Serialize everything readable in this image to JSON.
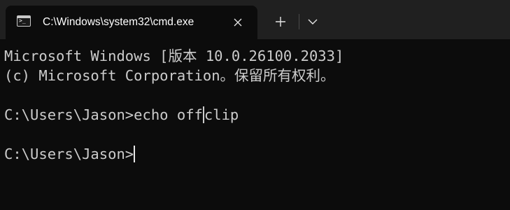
{
  "tab": {
    "title": "C:\\Windows\\system32\\cmd.exe",
    "icon": "cmd-terminal-icon",
    "close_icon": "close-icon"
  },
  "toolbar": {
    "new_tab_icon": "plus-icon",
    "dropdown_icon": "chevron-down-icon"
  },
  "terminal": {
    "header_line_1": "Microsoft Windows [版本 10.0.26100.2033]",
    "header_line_2": "(c) Microsoft Corporation。保留所有权利。",
    "prompt_1": "C:\\Users\\Jason>",
    "command_1_part_a": "echo off",
    "command_1_part_b": "clip",
    "prompt_2": "C:\\Users\\Jason>"
  },
  "colors": {
    "tabstrip_bg": "#202020",
    "terminal_bg": "#0c0c0c",
    "terminal_text": "#cccccc",
    "tab_text": "#ffffff"
  }
}
